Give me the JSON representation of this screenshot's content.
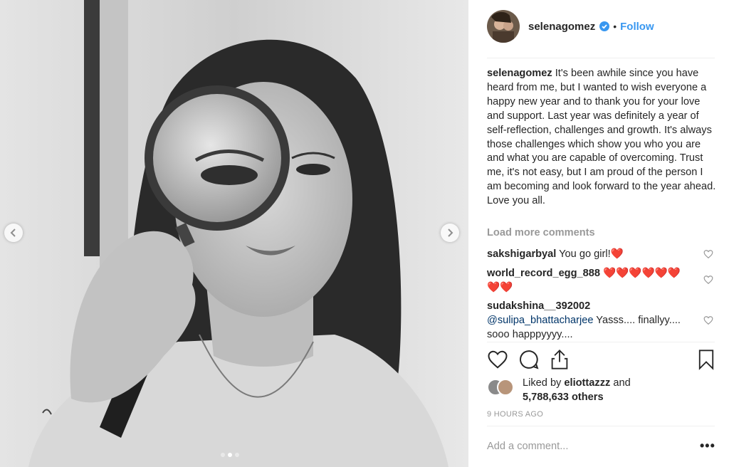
{
  "post": {
    "username": "selenagomez",
    "follow_label": "Follow",
    "bullet": "•",
    "caption_username": "selenagomez",
    "caption": " It's been awhile since you have heard from me, but I wanted to wish everyone a happy new year and to thank you for your love and support. Last year was definitely a year of self-reflection, challenges and growth. It's always those challenges which show you who you are and what you are capable of overcoming. Trust me, it's not easy, but I am proud of the person I am becoming and look forward to the year ahead. Love you all.",
    "load_more": "Load more comments",
    "comments": [
      {
        "username": "sakshigarbyal",
        "text": " You go girl!",
        "emoji": "❤️"
      },
      {
        "username": "world_record_egg_888",
        "text": " ",
        "emoji": "❤️❤️❤️❤️❤️❤️❤️❤️"
      },
      {
        "username": "sudakshina__392002",
        "mention": "@sulipa_bhattacharjee",
        "text": " Yasss.... finallyy.... sooo happpyyyy...."
      }
    ],
    "liked_prefix": "Liked by ",
    "liked_user": "eliottazzz",
    "liked_and": " and",
    "liked_count": "5,788,633 others",
    "timestamp": "9 HOURS AGO",
    "add_comment_placeholder": "Add a comment...",
    "more_label": "•••"
  },
  "carousel": {
    "count": 3,
    "active": 2
  },
  "colors": {
    "accent": "#3897f0",
    "heart": "#ed4956",
    "muted": "#999999",
    "text": "#262626"
  },
  "icons": [
    "chevron-left-icon",
    "chevron-right-icon",
    "verified-badge-icon",
    "heart-icon",
    "comment-icon",
    "share-icon",
    "bookmark-icon",
    "more-options-icon"
  ]
}
